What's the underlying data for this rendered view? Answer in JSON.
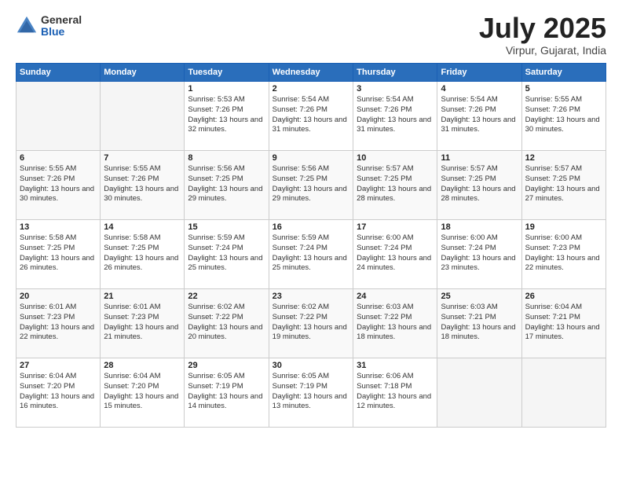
{
  "logo": {
    "general": "General",
    "blue": "Blue"
  },
  "header": {
    "month_year": "July 2025",
    "location": "Virpur, Gujarat, India"
  },
  "weekdays": [
    "Sunday",
    "Monday",
    "Tuesday",
    "Wednesday",
    "Thursday",
    "Friday",
    "Saturday"
  ],
  "weeks": [
    [
      {
        "day": "",
        "empty": true
      },
      {
        "day": "",
        "empty": true
      },
      {
        "day": "1",
        "sunrise": "Sunrise: 5:53 AM",
        "sunset": "Sunset: 7:26 PM",
        "daylight": "Daylight: 13 hours and 32 minutes."
      },
      {
        "day": "2",
        "sunrise": "Sunrise: 5:54 AM",
        "sunset": "Sunset: 7:26 PM",
        "daylight": "Daylight: 13 hours and 31 minutes."
      },
      {
        "day": "3",
        "sunrise": "Sunrise: 5:54 AM",
        "sunset": "Sunset: 7:26 PM",
        "daylight": "Daylight: 13 hours and 31 minutes."
      },
      {
        "day": "4",
        "sunrise": "Sunrise: 5:54 AM",
        "sunset": "Sunset: 7:26 PM",
        "daylight": "Daylight: 13 hours and 31 minutes."
      },
      {
        "day": "5",
        "sunrise": "Sunrise: 5:55 AM",
        "sunset": "Sunset: 7:26 PM",
        "daylight": "Daylight: 13 hours and 30 minutes."
      }
    ],
    [
      {
        "day": "6",
        "sunrise": "Sunrise: 5:55 AM",
        "sunset": "Sunset: 7:26 PM",
        "daylight": "Daylight: 13 hours and 30 minutes."
      },
      {
        "day": "7",
        "sunrise": "Sunrise: 5:55 AM",
        "sunset": "Sunset: 7:26 PM",
        "daylight": "Daylight: 13 hours and 30 minutes."
      },
      {
        "day": "8",
        "sunrise": "Sunrise: 5:56 AM",
        "sunset": "Sunset: 7:25 PM",
        "daylight": "Daylight: 13 hours and 29 minutes."
      },
      {
        "day": "9",
        "sunrise": "Sunrise: 5:56 AM",
        "sunset": "Sunset: 7:25 PM",
        "daylight": "Daylight: 13 hours and 29 minutes."
      },
      {
        "day": "10",
        "sunrise": "Sunrise: 5:57 AM",
        "sunset": "Sunset: 7:25 PM",
        "daylight": "Daylight: 13 hours and 28 minutes."
      },
      {
        "day": "11",
        "sunrise": "Sunrise: 5:57 AM",
        "sunset": "Sunset: 7:25 PM",
        "daylight": "Daylight: 13 hours and 28 minutes."
      },
      {
        "day": "12",
        "sunrise": "Sunrise: 5:57 AM",
        "sunset": "Sunset: 7:25 PM",
        "daylight": "Daylight: 13 hours and 27 minutes."
      }
    ],
    [
      {
        "day": "13",
        "sunrise": "Sunrise: 5:58 AM",
        "sunset": "Sunset: 7:25 PM",
        "daylight": "Daylight: 13 hours and 26 minutes."
      },
      {
        "day": "14",
        "sunrise": "Sunrise: 5:58 AM",
        "sunset": "Sunset: 7:25 PM",
        "daylight": "Daylight: 13 hours and 26 minutes."
      },
      {
        "day": "15",
        "sunrise": "Sunrise: 5:59 AM",
        "sunset": "Sunset: 7:24 PM",
        "daylight": "Daylight: 13 hours and 25 minutes."
      },
      {
        "day": "16",
        "sunrise": "Sunrise: 5:59 AM",
        "sunset": "Sunset: 7:24 PM",
        "daylight": "Daylight: 13 hours and 25 minutes."
      },
      {
        "day": "17",
        "sunrise": "Sunrise: 6:00 AM",
        "sunset": "Sunset: 7:24 PM",
        "daylight": "Daylight: 13 hours and 24 minutes."
      },
      {
        "day": "18",
        "sunrise": "Sunrise: 6:00 AM",
        "sunset": "Sunset: 7:24 PM",
        "daylight": "Daylight: 13 hours and 23 minutes."
      },
      {
        "day": "19",
        "sunrise": "Sunrise: 6:00 AM",
        "sunset": "Sunset: 7:23 PM",
        "daylight": "Daylight: 13 hours and 22 minutes."
      }
    ],
    [
      {
        "day": "20",
        "sunrise": "Sunrise: 6:01 AM",
        "sunset": "Sunset: 7:23 PM",
        "daylight": "Daylight: 13 hours and 22 minutes."
      },
      {
        "day": "21",
        "sunrise": "Sunrise: 6:01 AM",
        "sunset": "Sunset: 7:23 PM",
        "daylight": "Daylight: 13 hours and 21 minutes."
      },
      {
        "day": "22",
        "sunrise": "Sunrise: 6:02 AM",
        "sunset": "Sunset: 7:22 PM",
        "daylight": "Daylight: 13 hours and 20 minutes."
      },
      {
        "day": "23",
        "sunrise": "Sunrise: 6:02 AM",
        "sunset": "Sunset: 7:22 PM",
        "daylight": "Daylight: 13 hours and 19 minutes."
      },
      {
        "day": "24",
        "sunrise": "Sunrise: 6:03 AM",
        "sunset": "Sunset: 7:22 PM",
        "daylight": "Daylight: 13 hours and 18 minutes."
      },
      {
        "day": "25",
        "sunrise": "Sunrise: 6:03 AM",
        "sunset": "Sunset: 7:21 PM",
        "daylight": "Daylight: 13 hours and 18 minutes."
      },
      {
        "day": "26",
        "sunrise": "Sunrise: 6:04 AM",
        "sunset": "Sunset: 7:21 PM",
        "daylight": "Daylight: 13 hours and 17 minutes."
      }
    ],
    [
      {
        "day": "27",
        "sunrise": "Sunrise: 6:04 AM",
        "sunset": "Sunset: 7:20 PM",
        "daylight": "Daylight: 13 hours and 16 minutes."
      },
      {
        "day": "28",
        "sunrise": "Sunrise: 6:04 AM",
        "sunset": "Sunset: 7:20 PM",
        "daylight": "Daylight: 13 hours and 15 minutes."
      },
      {
        "day": "29",
        "sunrise": "Sunrise: 6:05 AM",
        "sunset": "Sunset: 7:19 PM",
        "daylight": "Daylight: 13 hours and 14 minutes."
      },
      {
        "day": "30",
        "sunrise": "Sunrise: 6:05 AM",
        "sunset": "Sunset: 7:19 PM",
        "daylight": "Daylight: 13 hours and 13 minutes."
      },
      {
        "day": "31",
        "sunrise": "Sunrise: 6:06 AM",
        "sunset": "Sunset: 7:18 PM",
        "daylight": "Daylight: 13 hours and 12 minutes."
      },
      {
        "day": "",
        "empty": true
      },
      {
        "day": "",
        "empty": true
      }
    ]
  ]
}
